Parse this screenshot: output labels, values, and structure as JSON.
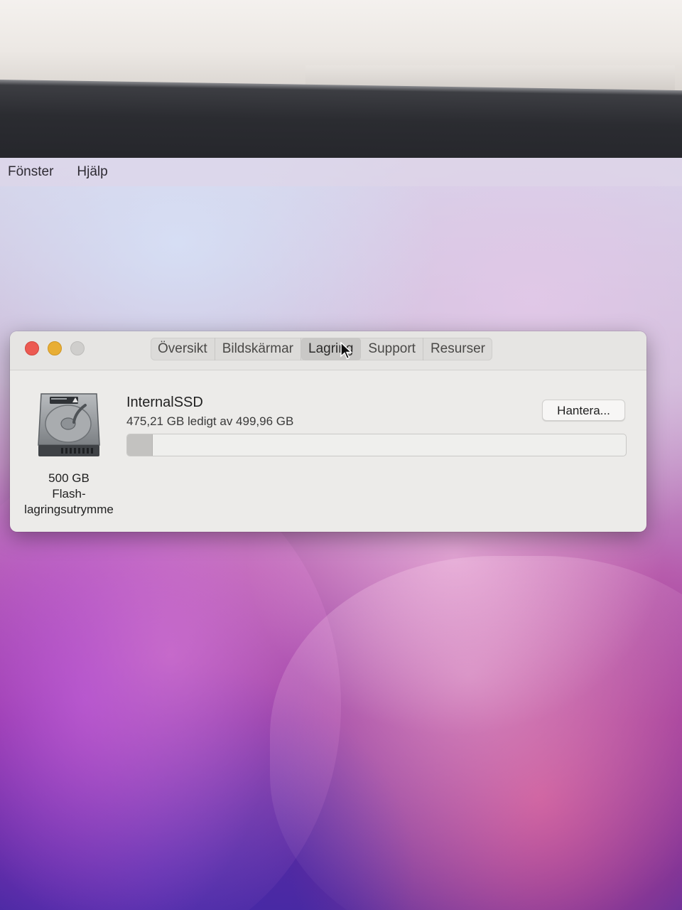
{
  "menubar": {
    "items": [
      "Fönster",
      "Hjälp"
    ]
  },
  "window": {
    "tabs": [
      {
        "label": "Översikt",
        "active": false
      },
      {
        "label": "Bildskärmar",
        "active": false
      },
      {
        "label": "Lagring",
        "active": true
      },
      {
        "label": "Support",
        "active": false
      },
      {
        "label": "Resurser",
        "active": false
      }
    ],
    "drive": {
      "icon": "hard-drive-icon",
      "caption_lines": [
        "500 GB",
        "Flash-",
        "lagringsutrymme"
      ]
    },
    "disk": {
      "name": "InternalSSD",
      "free_text": "475,21 GB ledigt av 499,96 GB",
      "used_fraction": 0.0495
    },
    "manage_label": "Hantera..."
  },
  "colors": {
    "close": "#ec5a52",
    "minimize": "#e8ae35",
    "zoom_disabled": "#cfcecc"
  }
}
